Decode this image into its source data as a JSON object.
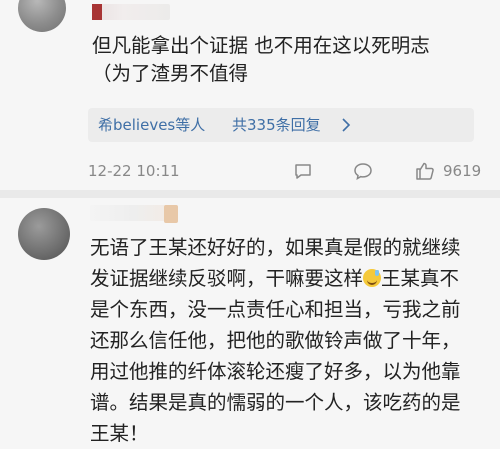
{
  "comment1": {
    "lines": [
      "但凡能拿出个证据 也不用在这以死明志",
      "（为了渣男不值得"
    ],
    "reply_summary": {
      "users": "希believes等人",
      "count": "共335条回复",
      "chevron_icon": "chevron-right-icon"
    },
    "timestamp": "12-22 10:11",
    "like_count": "9619",
    "icons": [
      "reply-icon",
      "comment-icon",
      "like-icon"
    ]
  },
  "comment2": {
    "lines": [
      "无语了王某还好好的，如果真是假的就继续",
      "发证据继续反驳啊，干嘛要这样",
      "王某真不",
      "是个东西，没一点责任心和担当，亏我之前",
      "还那么信任他，把他的歌做铃声做了十年，",
      "用过他推的纤体滚轮还瘦了好多，以为他靠",
      "谱。结果是真的懦弱的一个人，该吃药的是",
      "王某！"
    ],
    "emoji": "sweat-smile-emoji"
  },
  "colors": {
    "link": "#3f6fa6",
    "meta_text": "#888888",
    "background": "#f6f6f6",
    "reply_box": "#ececec"
  }
}
